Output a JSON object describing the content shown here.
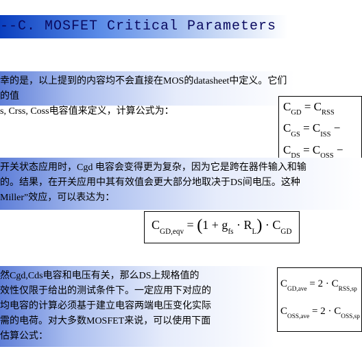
{
  "title": "--C. MOSFET Critical Parameters",
  "para1": {
    "l1": "幸的是，以上提到的内容均不会直接在MOS的datasheet中定义。它们的值",
    "l2": "s, Crss, Coss电容值来定义，计算公式为："
  },
  "eq1": {
    "a_lhs": "C",
    "a_sub": "GD",
    "a_eq": " = C",
    "a_rsub": "RSS",
    "b_lhs": "C",
    "b_sub": "GS",
    "b_eq": " = C",
    "b_rsub": "ISS",
    "b_tail": " −",
    "c_lhs": "C",
    "c_sub": "DS",
    "c_eq": " = C",
    "c_rsub": "OSS",
    "c_tail": " −"
  },
  "para2": {
    "l1": "开关状态应用时，Cgd 电容会变得更为复杂，因为它是跨在器件输入和输",
    "l2": "的。结果，在开关应用中其有效值会更大部分地取决于DS间电压。这种",
    "l3": "Miller”效应，可以表达为："
  },
  "eq2": {
    "lhs": "C",
    "lhs_sub": "GD,eqv",
    "mid1": " = ",
    "p1": "(",
    "one": "1 + g",
    "gsub": "fs",
    "dotR": " · R",
    "rsub": "L",
    "p2": ")",
    "dotC": " · C",
    "csub": "GD"
  },
  "para3": {
    "l1": "然Cgd,Cds电容和电压有关，那么DS上规格值的",
    "l2": "效性仅限于给出的测试条件下。一定应用下对应的",
    "l3": "均电容的计算必须基于建立电容两端电压变化实际",
    "l4": "需的电荷。对大多数MOSFET来说，可以使用下面",
    "l5": "估算公式："
  },
  "eq3": {
    "a_lhs": "C",
    "a_sub": "GD,ave",
    "a_mid": " = 2 · C",
    "a_rsub": "RSS,sp",
    "b_lhs": "C",
    "b_sub": "OSS,ave",
    "b_mid": " = 2 · C",
    "b_rsub": "OSS,sp"
  }
}
